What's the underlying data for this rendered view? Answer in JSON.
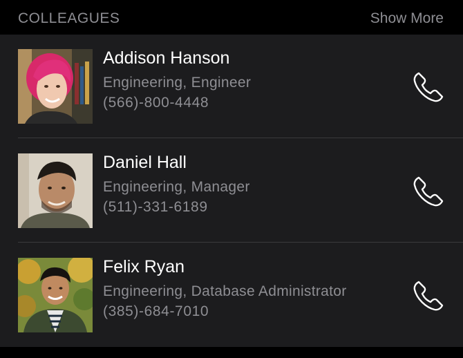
{
  "header": {
    "title": "COLLEAGUES",
    "show_more_label": "Show More"
  },
  "colleagues": [
    {
      "name": "Addison Hanson",
      "subtitle": "Engineering, Engineer",
      "phone": "(566)-800-4448",
      "avatar_icon": "avatar-photo",
      "call_icon": "phone-icon"
    },
    {
      "name": "Daniel Hall",
      "subtitle": "Engineering, Manager",
      "phone": "(511)-331-6189",
      "avatar_icon": "avatar-photo",
      "call_icon": "phone-icon"
    },
    {
      "name": "Felix Ryan",
      "subtitle": "Engineering, Database Administrator",
      "phone": "(385)-684-7010",
      "avatar_icon": "avatar-photo",
      "call_icon": "phone-icon"
    }
  ],
  "colors": {
    "background": "#000000",
    "list_background": "#1c1c1e",
    "primary_text": "#ffffff",
    "secondary_text": "#8e8e93",
    "divider": "#3a3a3c"
  }
}
